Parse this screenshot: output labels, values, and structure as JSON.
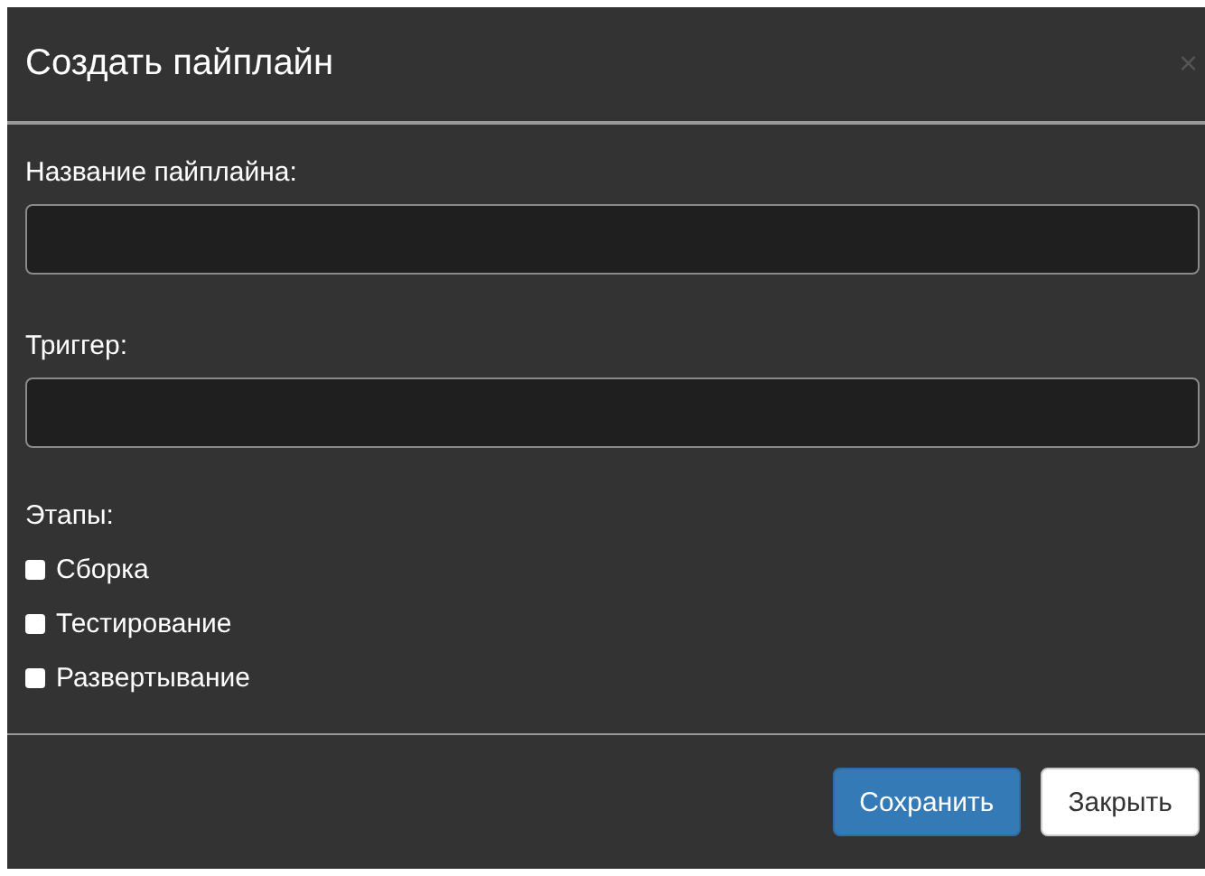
{
  "dialog": {
    "title": "Создать пайплайн",
    "close_icon": "×"
  },
  "fields": [
    {
      "label": "Название пайплайна:"
    },
    {
      "label": "Триггер:"
    }
  ],
  "stages": {
    "label": "Этапы:",
    "items": [
      {
        "label": "Сборка",
        "checked": false
      },
      {
        "label": "Тестирование",
        "checked": false
      },
      {
        "label": "Развертывание",
        "checked": false
      }
    ]
  },
  "buttons": [
    {
      "label": "Сохранить",
      "kind": "primary"
    },
    {
      "label": "Закрыть",
      "kind": "default"
    }
  ]
}
